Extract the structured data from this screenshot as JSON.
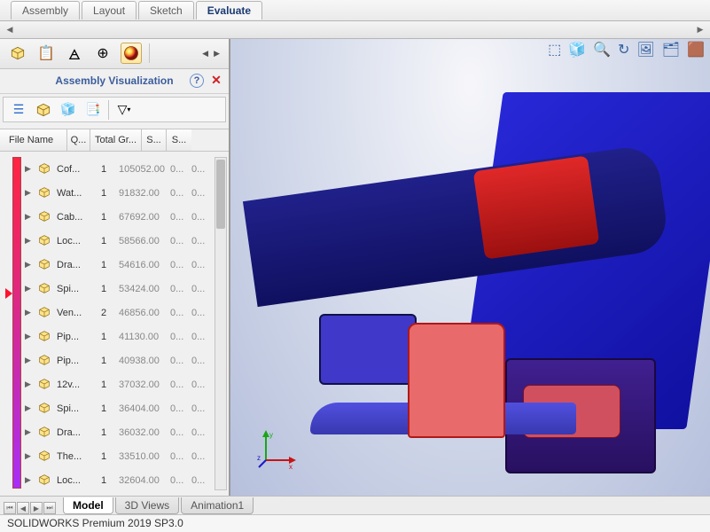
{
  "modeTabs": {
    "items": [
      "Assembly",
      "Layout",
      "Sketch",
      "Evaluate"
    ],
    "activeIndex": 3
  },
  "panel": {
    "title": "Assembly Visualization",
    "help": "?",
    "close": "✕",
    "columns": {
      "fname": "File Name",
      "q": "Q...",
      "tg": "Total Gr...",
      "sw": "S...",
      "sm": "S..."
    },
    "rows": [
      {
        "name": "Cof...",
        "q": "1",
        "tg": "105052.00",
        "sw": "0...",
        "sm": "0..."
      },
      {
        "name": "Wat...",
        "q": "1",
        "tg": "91832.00",
        "sw": "0...",
        "sm": "0..."
      },
      {
        "name": "Cab...",
        "q": "1",
        "tg": "67692.00",
        "sw": "0...",
        "sm": "0..."
      },
      {
        "name": "Loc...",
        "q": "1",
        "tg": "58566.00",
        "sw": "0...",
        "sm": "0..."
      },
      {
        "name": "Dra...",
        "q": "1",
        "tg": "54616.00",
        "sw": "0...",
        "sm": "0..."
      },
      {
        "name": "Spi...",
        "q": "1",
        "tg": "53424.00",
        "sw": "0...",
        "sm": "0..."
      },
      {
        "name": "Ven...",
        "q": "2",
        "tg": "46856.00",
        "sw": "0...",
        "sm": "0..."
      },
      {
        "name": "Pip...",
        "q": "1",
        "tg": "41130.00",
        "sw": "0...",
        "sm": "0..."
      },
      {
        "name": "Pip...",
        "q": "1",
        "tg": "40938.00",
        "sw": "0...",
        "sm": "0..."
      },
      {
        "name": "12v...",
        "q": "1",
        "tg": "37032.00",
        "sw": "0...",
        "sm": "0..."
      },
      {
        "name": "Spi...",
        "q": "1",
        "tg": "36404.00",
        "sw": "0...",
        "sm": "0..."
      },
      {
        "name": "Dra...",
        "q": "1",
        "tg": "36032.00",
        "sw": "0...",
        "sm": "0..."
      },
      {
        "name": "The...",
        "q": "1",
        "tg": "33510.00",
        "sw": "0...",
        "sm": "0..."
      },
      {
        "name": "Loc...",
        "q": "1",
        "tg": "32604.00",
        "sw": "0...",
        "sm": "0..."
      }
    ]
  },
  "bottomTabs": {
    "items": [
      "Model",
      "3D Views",
      "Animation1"
    ],
    "activeIndex": 0
  },
  "status": "SOLIDWORKS Premium 2019 SP3.0"
}
